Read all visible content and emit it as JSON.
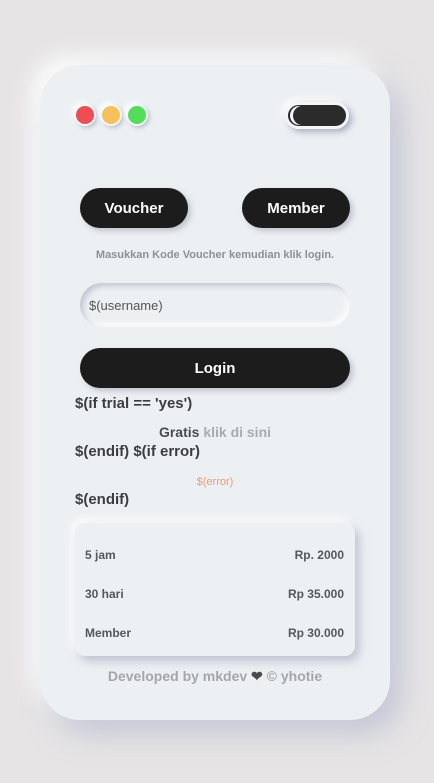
{
  "toggle": {
    "state": "dark"
  },
  "tabs": {
    "voucher": "Voucher",
    "member": "Member"
  },
  "hint": "Masukkan Kode Voucher kemudian klik login.",
  "username": {
    "placeholder": "$(username)"
  },
  "login_label": "Login",
  "template": {
    "if_trial": "$(if trial == 'yes')",
    "gratis": "Gratis",
    "klik": "klik di sini",
    "endif_if_error": "$(endif) $(if error)",
    "error": "$(error)",
    "endif": "$(endif)"
  },
  "prices": [
    {
      "label": "5 jam",
      "price": "Rp. 2000"
    },
    {
      "label": "30 hari",
      "price": "Rp 35.000"
    },
    {
      "label": "Member",
      "price": "Rp 30.000"
    }
  ],
  "footer": {
    "before": "Developed by mkdev",
    "heart": "❤",
    "after": "© yhotie"
  },
  "colors": {
    "red_dot": "#ee4d53",
    "yellow_dot": "#f5c15d",
    "green_dot": "#52dd5a",
    "button": "#1c1c1c",
    "error": "#f09a73"
  }
}
